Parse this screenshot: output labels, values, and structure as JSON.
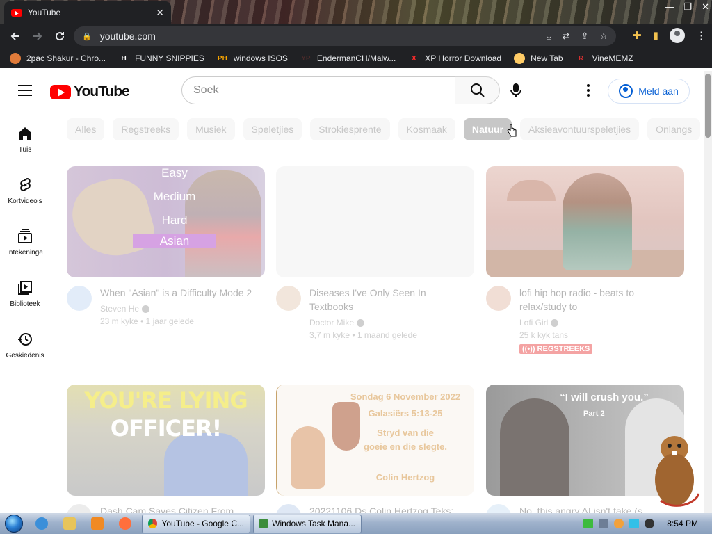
{
  "browser": {
    "tab_title": "YouTube",
    "tab_close": "✕",
    "url": "youtube.com",
    "window_controls": [
      "—",
      "❐",
      "✕"
    ],
    "bookmarks": [
      {
        "label": "2pac Shakur - Chro...",
        "icon": "shopping-icon",
        "color": "#e07b3a"
      },
      {
        "label": "FUNNY SNIPPIES",
        "icon": "H",
        "color": "#ffffff"
      },
      {
        "label": "windows ISOS",
        "icon": "PH",
        "color": "#f7a400"
      },
      {
        "label": "EndermanCH/Malw...",
        "icon": "YP",
        "color": "#4a2a2a"
      },
      {
        "label": "XP Horror Download",
        "icon": "X",
        "color": "#ff2b2b"
      },
      {
        "label": "New Tab",
        "icon": "globe-icon",
        "color": "#ffcc66"
      },
      {
        "label": "VineMEMZ",
        "icon": "R",
        "color": "#d32f2f"
      }
    ]
  },
  "youtube": {
    "logo_text": "YouTube",
    "search_placeholder": "Soek",
    "signin_label": "Meld aan",
    "guide": [
      {
        "label": "Tuis",
        "icon": "home-icon"
      },
      {
        "label": "Kortvideo's",
        "icon": "shorts-icon"
      },
      {
        "label": "Intekeninge",
        "icon": "subscriptions-icon"
      },
      {
        "label": "Biblioteek",
        "icon": "library-icon"
      },
      {
        "label": "Geskiedenis",
        "icon": "history-icon"
      }
    ],
    "chips": [
      "Alles",
      "Regstreeks",
      "Musiek",
      "Speletjies",
      "Strokiesprente",
      "Kosmaak",
      "Natuur",
      "Aksieavontuurspeletjies",
      "Onlangs"
    ],
    "active_chip": "Natuur",
    "videos": [
      {
        "title": "When \"Asian\" is a Difficulty Mode 2",
        "channel": "Steven He",
        "stats": "23 m kyke • 1 jaar gelede",
        "thumb_levels": [
          "Easy",
          "Medium",
          "Hard",
          "Asian"
        ]
      },
      {
        "title": "Diseases I've Only Seen In Textbooks",
        "channel": "Doctor Mike",
        "stats": "3,7 m kyke • 1 maand gelede"
      },
      {
        "title": "lofi hip hop radio - beats to relax/study to",
        "channel": "Lofi Girl",
        "stats": "25 k kyk tans",
        "badge": "((•)) REGSTREEKS"
      },
      {
        "title": "Dash Cam Saves Citizen From...",
        "thumb_text": [
          "YOU'RE LYING",
          "OFFICER!"
        ]
      },
      {
        "title": "20221106 Ds Colin Hertzog Teks:...",
        "thumb_text": [
          "Sondag 6 November 2022",
          "Galasiërs 5:13-25",
          "Stryd van die",
          "goeie en die slegte.",
          "Colin Hertzog"
        ]
      },
      {
        "title": "No, this angry AI isn't fake (s...",
        "thumb_text": [
          "“I will crush you.”",
          "Part 2"
        ]
      }
    ]
  },
  "taskbar": {
    "buttons": [
      {
        "label": "YouTube - Google C...",
        "color": "#e53935"
      },
      {
        "label": "Windows Task Mana...",
        "color": "#3c8d3c"
      }
    ],
    "clock": "8:54 PM"
  }
}
